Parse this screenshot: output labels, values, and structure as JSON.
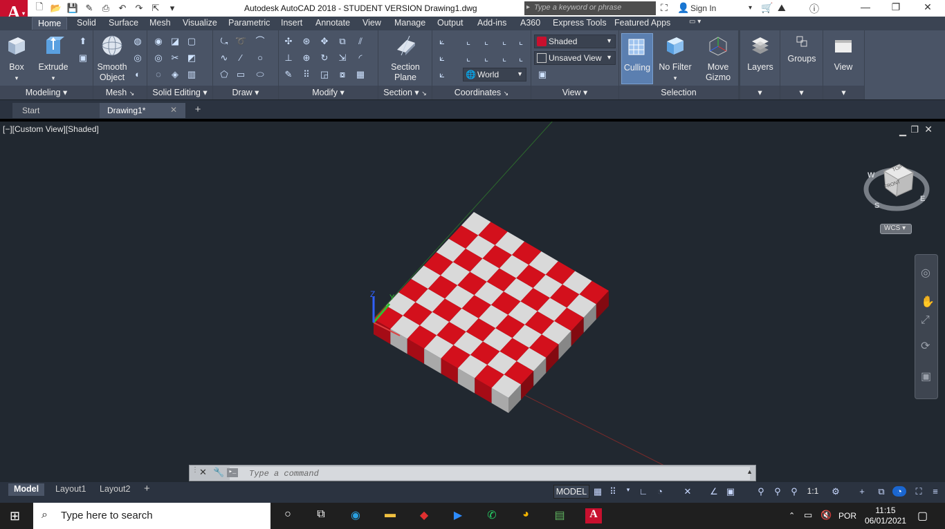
{
  "titlebar": {
    "app_logo": "A",
    "title": "Autodesk AutoCAD 2018 - STUDENT VERSION    Drawing1.dwg",
    "search_placeholder": "Type a keyword or phrase",
    "sign_in": "Sign In"
  },
  "ribbon_tabs": [
    "Home",
    "Solid",
    "Surface",
    "Mesh",
    "Visualize",
    "Parametric",
    "Insert",
    "Annotate",
    "View",
    "Manage",
    "Output",
    "Add-ins",
    "A360",
    "Express Tools",
    "Featured Apps"
  ],
  "panels": {
    "modeling": {
      "title": "Modeling",
      "box": "Box",
      "extrude": "Extrude"
    },
    "mesh": {
      "title": "Mesh",
      "smooth_object": "Smooth\nObject"
    },
    "solid_editing": {
      "title": "Solid Editing"
    },
    "draw": {
      "title": "Draw"
    },
    "modify": {
      "title": "Modify"
    },
    "section": {
      "title": "Section",
      "section_plane": "Section\nPlane"
    },
    "coordinates": {
      "title": "Coordinates",
      "world": "World"
    },
    "view": {
      "title": "View",
      "visual_style": "Shaded",
      "named_view": "Unsaved View"
    },
    "selection": {
      "title": "Selection",
      "culling": "Culling",
      "no_filter": "No Filter",
      "move_gizmo": "Move\nGizmo"
    },
    "layers": {
      "label": "Layers"
    },
    "groups": {
      "label": "Groups"
    },
    "viewpanel": {
      "label": "View"
    }
  },
  "file_tabs": {
    "start": "Start",
    "drawing": "Drawing1*"
  },
  "viewport": {
    "label": "[−][Custom View][Shaded]",
    "viewcube_top": "TOP",
    "viewcube_front": "FRONT",
    "compass_w": "W",
    "compass_s": "S",
    "compass_e": "E",
    "wcs": "WCS",
    "colors": {
      "red": "#d3101c",
      "white": "#d9d9d9",
      "background": "#212830"
    }
  },
  "command_line": {
    "placeholder": "Type a command"
  },
  "layout_tabs": [
    "Model",
    "Layout1",
    "Layout2"
  ],
  "statusbar": {
    "model": "MODEL",
    "scale": "1:1"
  },
  "taskbar": {
    "search": "Type here to search",
    "lang": "POR",
    "time": "11:15",
    "date": "06/01/2021"
  }
}
